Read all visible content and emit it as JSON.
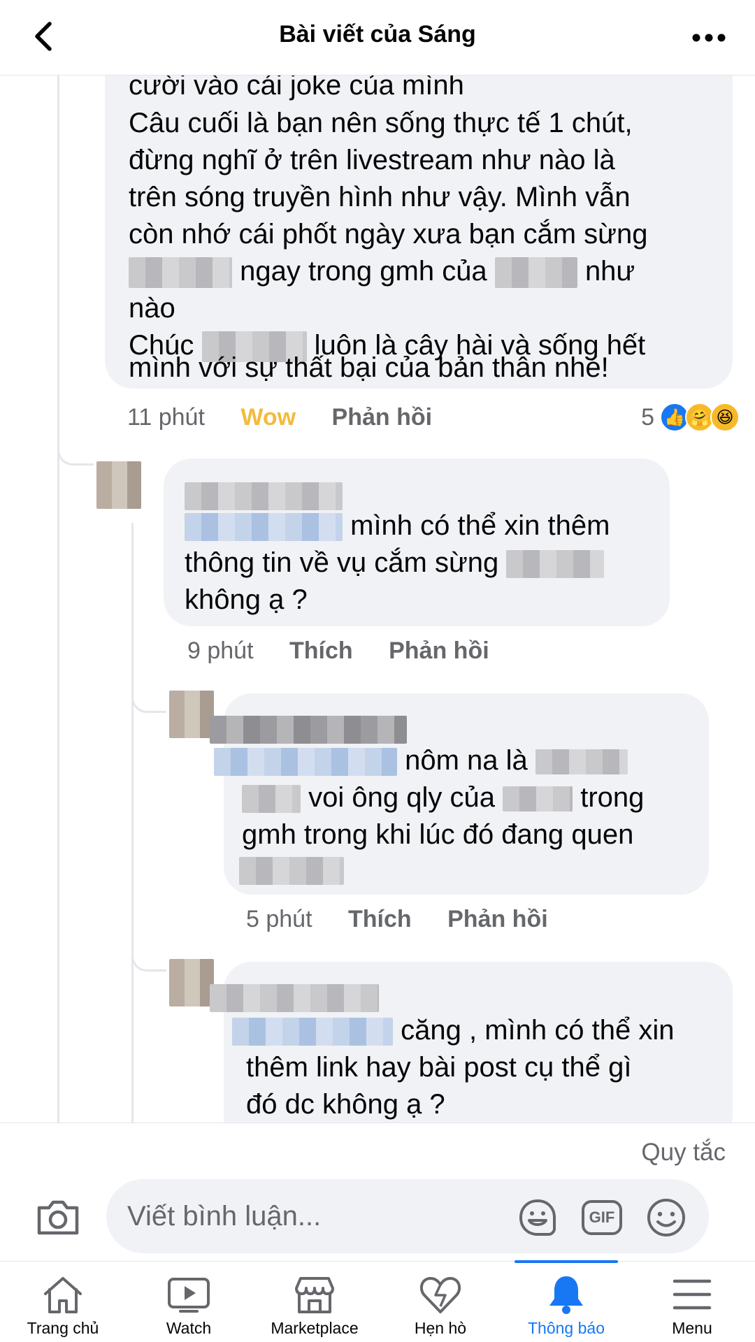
{
  "header": {
    "title": "Bài viết của Sáng"
  },
  "comment_1": {
    "line_cut": "cười vào cái joke của mình",
    "line_1": "Câu cuối là bạn nên sống thực tế 1 chút,",
    "line_2": "đừng nghĩ ở trên livestream như nào là",
    "line_3": "trên sóng truyền hình như vậy. Mình vẫn",
    "line_4": "còn nhớ cái phốt ngày xưa bạn cắm sừng",
    "line_5_text": "ngay trong gmh của",
    "line_5_tail": "như",
    "line_6": "nào",
    "line_7_head": "Chúc",
    "line_7_tail": "luôn là cây hài và sống hết",
    "line_8": "mình với sự thất bại của bản thân nhé!",
    "time": "11 phút",
    "reaction_label": "Wow",
    "reply_label": "Phản hồi",
    "reaction_count": "5"
  },
  "reply_1": {
    "line_1": "mình có thể xin thêm",
    "line_2": "thông tin về vụ cắm sừng",
    "line_3": "không ạ ?",
    "time": "9 phút",
    "like_label": "Thích",
    "reply_label": "Phản hồi"
  },
  "reply_2": {
    "line_1": "nôm na là",
    "line_2a": "voi ông qly của",
    "line_2b": "trong",
    "line_3": "gmh trong khi lúc đó đang quen",
    "time": "5 phút",
    "like_label": "Thích",
    "reply_label": "Phản hồi"
  },
  "reply_3": {
    "line_1": "căng , mình có thể xin",
    "line_2": "thêm link hay bài post cụ thể gì",
    "line_3": "đó dc không ạ ?"
  },
  "composer": {
    "rules_label": "Quy tắc",
    "placeholder": "Viết bình luận...",
    "gif_label": "GIF"
  },
  "nav": {
    "tabs": [
      {
        "label": "Trang chủ",
        "icon": "home-icon"
      },
      {
        "label": "Watch",
        "icon": "watch-icon"
      },
      {
        "label": "Marketplace",
        "icon": "marketplace-icon"
      },
      {
        "label": "Hẹn hò",
        "icon": "dating-heart-icon"
      },
      {
        "label": "Thông báo",
        "icon": "bell-icon",
        "active": true
      },
      {
        "label": "Menu",
        "icon": "hamburger-icon"
      }
    ]
  },
  "colors": {
    "accent": "#1877f2",
    "wow": "#f2bb3c",
    "bubble": "#f0f2f5",
    "meta": "#65676b"
  }
}
